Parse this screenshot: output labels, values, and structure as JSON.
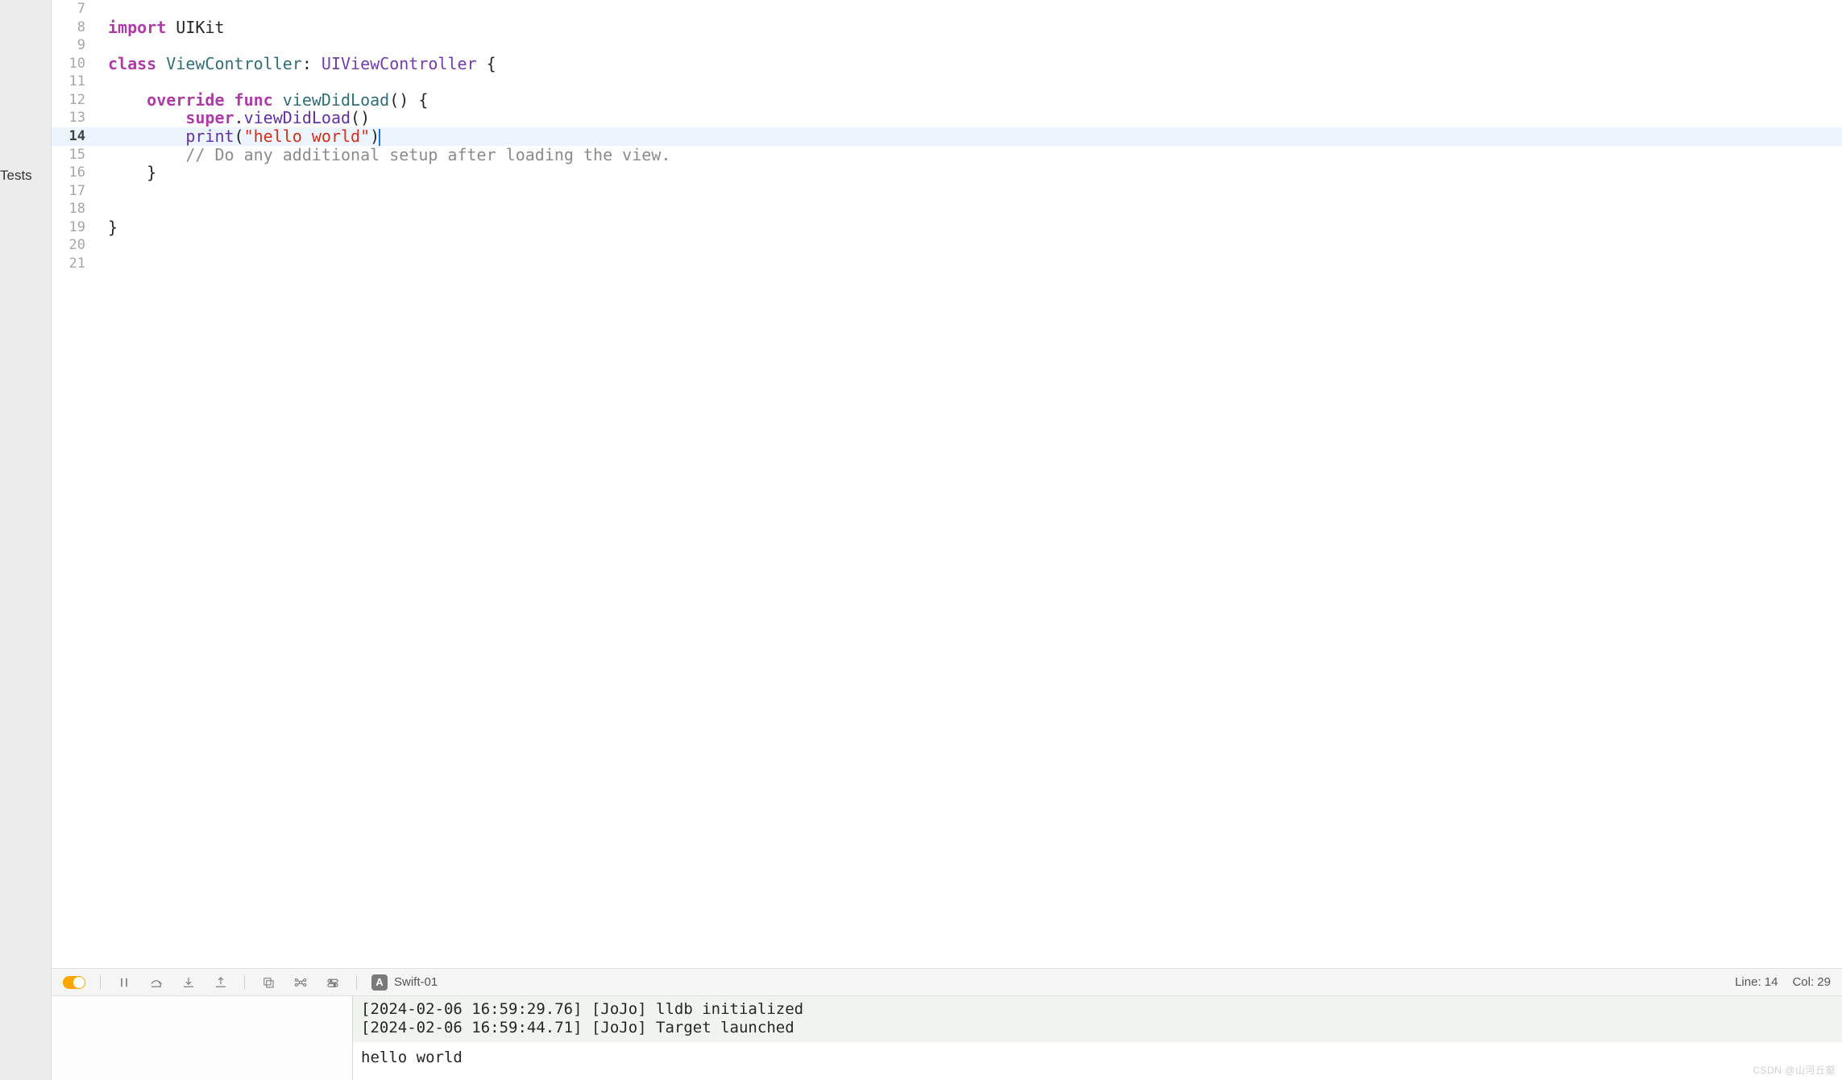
{
  "sidebar": {
    "partial_label": "Tests"
  },
  "editor": {
    "lines": [
      {
        "num": 7,
        "tokens": []
      },
      {
        "num": 8,
        "tokens": [
          {
            "t": "import ",
            "c": "kw-pink"
          },
          {
            "t": "UIKit",
            "c": ""
          }
        ]
      },
      {
        "num": 9,
        "tokens": []
      },
      {
        "num": 10,
        "tokens": [
          {
            "t": "class ",
            "c": "kw-pink"
          },
          {
            "t": "ViewController",
            "c": "ident-teal"
          },
          {
            "t": ": ",
            "c": ""
          },
          {
            "t": "UIViewController",
            "c": "kw-purple"
          },
          {
            "t": " {",
            "c": ""
          }
        ]
      },
      {
        "num": 11,
        "tokens": []
      },
      {
        "num": 12,
        "tokens": [
          {
            "t": "    ",
            "c": ""
          },
          {
            "t": "override func ",
            "c": "kw-pink"
          },
          {
            "t": "viewDidLoad",
            "c": "fn-teal"
          },
          {
            "t": "() {",
            "c": ""
          }
        ]
      },
      {
        "num": 13,
        "tokens": [
          {
            "t": "        ",
            "c": ""
          },
          {
            "t": "super",
            "c": "kw-pink"
          },
          {
            "t": ".",
            "c": ""
          },
          {
            "t": "viewDidLoad",
            "c": "fn-purple"
          },
          {
            "t": "()",
            "c": ""
          }
        ]
      },
      {
        "num": 14,
        "highlighted": true,
        "bold_gutter": true,
        "cursor_after": true,
        "tokens": [
          {
            "t": "        ",
            "c": ""
          },
          {
            "t": "print",
            "c": "fn-purple"
          },
          {
            "t": "(",
            "c": ""
          },
          {
            "t": "\"hello world\"",
            "c": "str-red"
          },
          {
            "t": ")",
            "c": ""
          }
        ]
      },
      {
        "num": 15,
        "tokens": [
          {
            "t": "        ",
            "c": ""
          },
          {
            "t": "// Do any additional setup after loading the view.",
            "c": "comment"
          }
        ]
      },
      {
        "num": 16,
        "tokens": [
          {
            "t": "    }",
            "c": ""
          }
        ]
      },
      {
        "num": 17,
        "tokens": []
      },
      {
        "num": 18,
        "tokens": []
      },
      {
        "num": 19,
        "tokens": [
          {
            "t": "}",
            "c": ""
          }
        ]
      },
      {
        "num": 20,
        "tokens": []
      },
      {
        "num": 21,
        "tokens": []
      }
    ]
  },
  "bottom_bar": {
    "target_icon_letter": "A",
    "target_name": "Swift-01",
    "line_label": "Line: 14",
    "col_label": "Col: 29"
  },
  "console": {
    "log_lines": [
      "[2024-02-06 16:59:29.76] [JoJo] lldb initialized",
      "[2024-02-06 16:59:44.71] [JoJo] Target launched"
    ],
    "stdout": "hello world"
  },
  "watermark": "CSDN @山河丘壑"
}
